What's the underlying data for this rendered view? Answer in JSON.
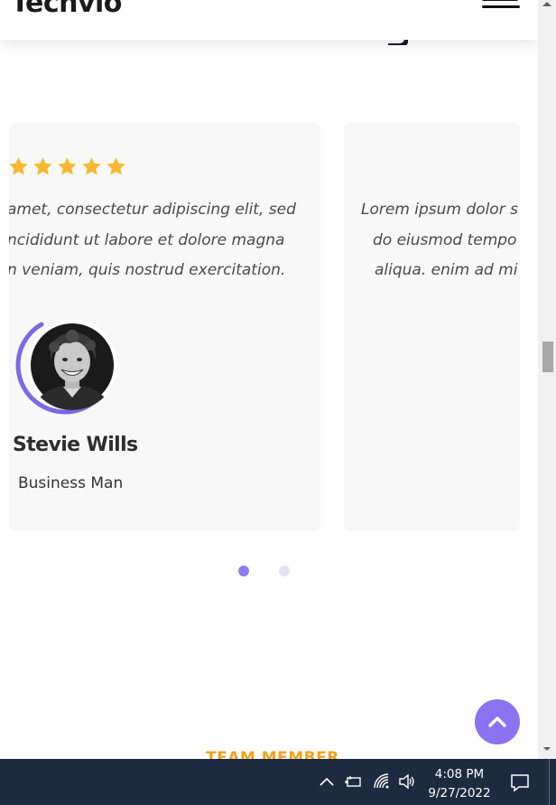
{
  "header": {
    "logo_text": "Techvio",
    "menu_icon": "hamburger-menu-icon"
  },
  "testimonials": [
    {
      "rating": 5,
      "quote_lines": [
        "amet, consectetur adipiscing elit, sed",
        "ncididunt ut labore et dolore magna",
        "n veniam, quis nostrud exercitation."
      ],
      "name": "Stevie Wills",
      "role": "Business Man"
    },
    {
      "quote_lines": [
        "Lorem ipsum dolor s",
        "do eiusmod tempo",
        "aliqua. enim ad mi"
      ]
    }
  ],
  "carousel": {
    "dot_count": 2,
    "active_index": 0
  },
  "next_section": {
    "label": "TEAM MEMBER"
  },
  "taskbar": {
    "time": "4:08 PM",
    "date": "9/27/2022",
    "tray_icons": [
      "chevron-up-icon",
      "battery-icon",
      "wifi-icon",
      "speaker-icon",
      "action-center-icon"
    ]
  },
  "colors": {
    "accent": "#8b72f0",
    "star": "#f7b731",
    "orange_label": "#f5a019",
    "taskbar": "#1d2b40"
  }
}
